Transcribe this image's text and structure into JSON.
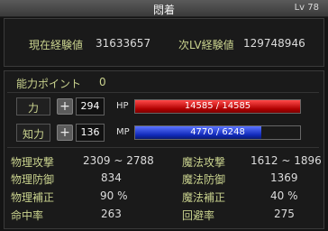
{
  "window": {
    "title": "悶着",
    "level": "Lv 78"
  },
  "experience": {
    "current_label": "現在経験値",
    "current_value": "31633657",
    "next_label": "次LV経験値",
    "next_value": "129748946"
  },
  "ability_points": {
    "label": "能力ポイント",
    "value": "0"
  },
  "str": {
    "label": "力",
    "plus": "+",
    "value": "294"
  },
  "int": {
    "label": "知力",
    "plus": "+",
    "value": "136"
  },
  "hp": {
    "label": "HP",
    "text": "14585 / 14585",
    "fill": 1.0,
    "color": "#c00000"
  },
  "mp": {
    "label": "MP",
    "text": "4770 / 6248",
    "fill": 0.7634,
    "color": "#1530c8"
  },
  "stats": {
    "left": [
      {
        "label": "物理攻撃",
        "value": "2309 ~ 2788"
      },
      {
        "label": "物理防御",
        "value": "834"
      },
      {
        "label": "物理補正",
        "value": "90 %"
      },
      {
        "label": "命中率",
        "value": "263"
      }
    ],
    "right": [
      {
        "label": "魔法攻撃",
        "value": "1612 ~ 1896"
      },
      {
        "label": "魔法防御",
        "value": "1369"
      },
      {
        "label": "魔法補正",
        "value": "40 %"
      },
      {
        "label": "回避率",
        "value": "275"
      }
    ]
  }
}
